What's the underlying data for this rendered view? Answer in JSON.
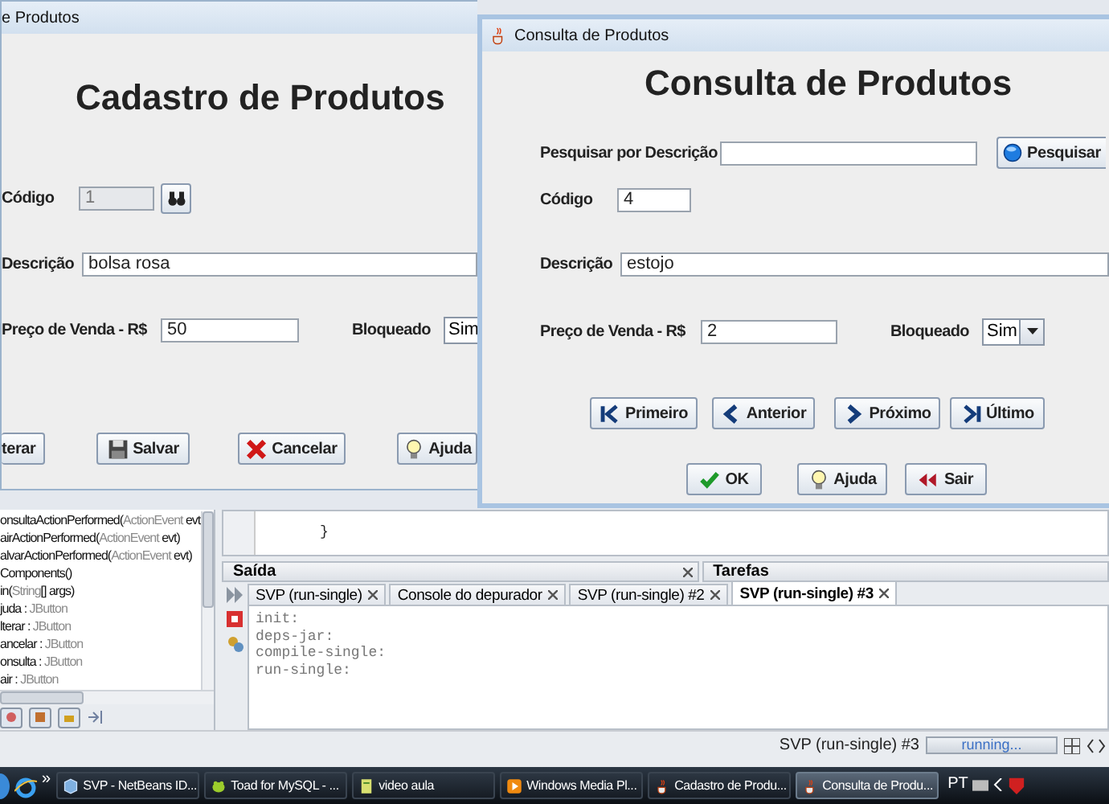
{
  "cadastro": {
    "title": "e Produtos",
    "heading": "Cadastro de Produtos",
    "codigo": {
      "label": "Código",
      "value": "1",
      "disabled": true
    },
    "descricao": {
      "label": "Descrição",
      "value": "bolsa rosa"
    },
    "preco": {
      "label": "Preço de Venda - R$",
      "value": "50"
    },
    "bloqueado": {
      "label": "Bloqueado",
      "value": "Sim"
    },
    "buttons": [
      {
        "label": "terar",
        "kind": "plain"
      },
      {
        "label": "Salvar",
        "kind": "save"
      },
      {
        "label": "Cancelar",
        "kind": "cancel"
      },
      {
        "label": "Ajuda",
        "kind": "help"
      }
    ]
  },
  "consulta": {
    "title": "Consulta de Produtos",
    "heading": "Consulta de Produtos",
    "search": {
      "label": "Pesquisar por Descrição",
      "button": "Pesquisar"
    },
    "codigo": {
      "label": "Código",
      "value": "4",
      "disabled": false
    },
    "descricao": {
      "label": "Descrição",
      "value": "estojo"
    },
    "preco": {
      "label": "Preço de Venda - R$",
      "value": "2"
    },
    "bloqueado": {
      "label": "Bloqueado",
      "value": "Sim"
    },
    "nav_buttons": [
      {
        "label": "Primeiro",
        "kind": "first"
      },
      {
        "label": "Anterior",
        "kind": "prev"
      },
      {
        "label": "Próximo",
        "kind": "next"
      },
      {
        "label": "Último",
        "kind": "last"
      }
    ],
    "action_buttons": [
      {
        "label": "OK",
        "kind": "ok"
      },
      {
        "label": "Ajuda",
        "kind": "help"
      },
      {
        "label": "Sair",
        "kind": "exit"
      }
    ]
  },
  "navigator": {
    "items": [
      {
        "before": "onsultaActionPerformed(",
        "type": "ActionEvent",
        "after": " evt"
      },
      {
        "before": "airActionPerformed(",
        "type": "ActionEvent",
        "after": " evt)"
      },
      {
        "before": "alvarActionPerformed(",
        "type": "ActionEvent",
        "after": " evt)"
      },
      {
        "before": "Components()"
      },
      {
        "before": "in(",
        "type": "String",
        "after": "[] args)"
      },
      {
        "before": "juda : ",
        "type": "JButton"
      },
      {
        "before": "lterar : ",
        "type": "JButton"
      },
      {
        "before": "ancelar : ",
        "type": "JButton"
      },
      {
        "before": "onsulta : ",
        "type": "JButton"
      },
      {
        "before": "air : ",
        "type": "JButton"
      }
    ]
  },
  "editor": {
    "lines": [
      "}"
    ]
  },
  "output": {
    "title": "Saída",
    "tasks_title": "Tarefas",
    "tabs": [
      {
        "label": "SVP (run-single)",
        "selected": false
      },
      {
        "label": "Console do depurador",
        "selected": false
      },
      {
        "label": "SVP (run-single) #2",
        "selected": false
      },
      {
        "label": "SVP (run-single) #3",
        "selected": true
      }
    ],
    "lines": [
      "init:",
      "deps-jar:",
      "compile-single:",
      "run-single:"
    ]
  },
  "status_bar": {
    "task": "SVP (run-single) #3",
    "progress": "running...",
    "level": 1
  },
  "taskbar": {
    "more": "»",
    "language": "PT",
    "items": [
      {
        "label": "SVP - NetBeans ID...",
        "kind": "netbeans",
        "selected": false
      },
      {
        "label": "Toad for MySQL - ...",
        "kind": "toad",
        "selected": false
      },
      {
        "label": "video aula",
        "kind": "folder",
        "selected": false
      },
      {
        "label": "Windows Media Pl...",
        "kind": "player",
        "selected": false
      },
      {
        "label": "Cadastro de Produ...",
        "kind": "java",
        "selected": false
      },
      {
        "label": "Consulta de Produ...",
        "kind": "java",
        "selected": true
      }
    ]
  }
}
